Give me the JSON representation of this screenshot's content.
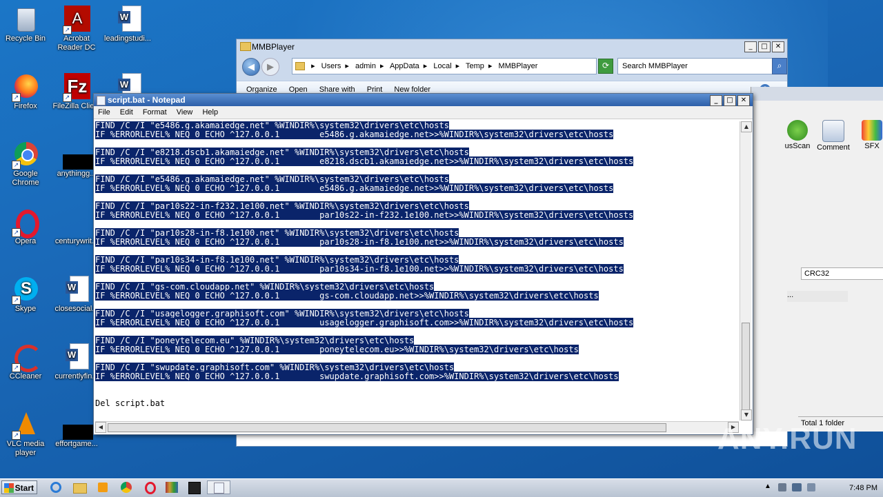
{
  "desktop": {
    "icons": [
      {
        "label": "Recycle Bin"
      },
      {
        "label": "Acrobat Reader DC"
      },
      {
        "label": "leadingstudi..."
      },
      {
        "label": "Firefox"
      },
      {
        "label": "FileZilla Clie..."
      },
      {
        "label": "Google Chrome"
      },
      {
        "label": "anythingg..."
      },
      {
        "label": "Opera"
      },
      {
        "label": "centurywrit..."
      },
      {
        "label": "Skype"
      },
      {
        "label": "closesocial..."
      },
      {
        "label": "CCleaner"
      },
      {
        "label": "currentlyfin..."
      },
      {
        "label": "VLC media player"
      },
      {
        "label": "effortgame..."
      }
    ]
  },
  "explorer": {
    "title": "MMBPlayer",
    "path": [
      "Users",
      "admin",
      "AppData",
      "Local",
      "Temp",
      "MMBPlayer"
    ],
    "search_placeholder": "Search MMBPlayer",
    "commands": [
      "Organize",
      "Open",
      "Share with",
      "Print",
      "New folder"
    ]
  },
  "rar": {
    "tools": [
      "usScan",
      "Comment",
      "SFX"
    ],
    "column": "CRC32",
    "row": "...",
    "status": "Total 1 folder"
  },
  "notepad": {
    "title": "script.bat - Notepad",
    "menu": [
      "File",
      "Edit",
      "Format",
      "View",
      "Help"
    ],
    "lines": [
      {
        "text": "FIND /C /I \"e5486.g.akamaiedge.net\" %WINDIR%\\system32\\drivers\\etc\\hosts",
        "selected": true
      },
      {
        "text": "IF %ERRORLEVEL% NEQ 0 ECHO ^127.0.0.1        e5486.g.akamaiedge.net>>%WINDIR%\\system32\\drivers\\etc\\hosts",
        "selected": true
      },
      {
        "text": "",
        "selected": true
      },
      {
        "text": "FIND /C /I \"e8218.dscb1.akamaiedge.net\" %WINDIR%\\system32\\drivers\\etc\\hosts",
        "selected": true
      },
      {
        "text": "IF %ERRORLEVEL% NEQ 0 ECHO ^127.0.0.1        e8218.dscb1.akamaiedge.net>>%WINDIR%\\system32\\drivers\\etc\\hosts",
        "selected": true
      },
      {
        "text": "",
        "selected": true
      },
      {
        "text": "FIND /C /I \"e5486.g.akamaiedge.net\" %WINDIR%\\system32\\drivers\\etc\\hosts",
        "selected": true
      },
      {
        "text": "IF %ERRORLEVEL% NEQ 0 ECHO ^127.0.0.1        e5486.g.akamaiedge.net>>%WINDIR%\\system32\\drivers\\etc\\hosts",
        "selected": true
      },
      {
        "text": "",
        "selected": true
      },
      {
        "text": "FIND /C /I \"par10s22-in-f232.1e100.net\" %WINDIR%\\system32\\drivers\\etc\\hosts",
        "selected": true
      },
      {
        "text": "IF %ERRORLEVEL% NEQ 0 ECHO ^127.0.0.1        par10s22-in-f232.1e100.net>>%WINDIR%\\system32\\drivers\\etc\\hosts",
        "selected": true
      },
      {
        "text": "",
        "selected": true
      },
      {
        "text": "FIND /C /I \"par10s28-in-f8.1e100.net\" %WINDIR%\\system32\\drivers\\etc\\hosts",
        "selected": true
      },
      {
        "text": "IF %ERRORLEVEL% NEQ 0 ECHO ^127.0.0.1        par10s28-in-f8.1e100.net>>%WINDIR%\\system32\\drivers\\etc\\hosts",
        "selected": true
      },
      {
        "text": "",
        "selected": true
      },
      {
        "text": "FIND /C /I \"par10s34-in-f8.1e100.net\" %WINDIR%\\system32\\drivers\\etc\\hosts",
        "selected": true
      },
      {
        "text": "IF %ERRORLEVEL% NEQ 0 ECHO ^127.0.0.1        par10s34-in-f8.1e100.net>>%WINDIR%\\system32\\drivers\\etc\\hosts",
        "selected": true
      },
      {
        "text": "",
        "selected": true
      },
      {
        "text": "FIND /C /I \"gs-com.cloudapp.net\" %WINDIR%\\system32\\drivers\\etc\\hosts",
        "selected": true
      },
      {
        "text": "IF %ERRORLEVEL% NEQ 0 ECHO ^127.0.0.1        gs-com.cloudapp.net>>%WINDIR%\\system32\\drivers\\etc\\hosts",
        "selected": true
      },
      {
        "text": "",
        "selected": true
      },
      {
        "text": "FIND /C /I \"usagelogger.graphisoft.com\" %WINDIR%\\system32\\drivers\\etc\\hosts",
        "selected": true
      },
      {
        "text": "IF %ERRORLEVEL% NEQ 0 ECHO ^127.0.0.1        usagelogger.graphisoft.com>>%WINDIR%\\system32\\drivers\\etc\\hosts",
        "selected": true
      },
      {
        "text": "",
        "selected": true
      },
      {
        "text": "FIND /C /I \"poneytelecom.eu\" %WINDIR%\\system32\\drivers\\etc\\hosts",
        "selected": true
      },
      {
        "text": "IF %ERRORLEVEL% NEQ 0 ECHO ^127.0.0.1        poneytelecom.eu>>%WINDIR%\\system32\\drivers\\etc\\hosts",
        "selected": true
      },
      {
        "text": "",
        "selected": true
      },
      {
        "text": "FIND /C /I \"swupdate.graphisoft.com\" %WINDIR%\\system32\\drivers\\etc\\hosts",
        "selected": true
      },
      {
        "text": "IF %ERRORLEVEL% NEQ 0 ECHO ^127.0.0.1        swupdate.graphisoft.com>>%WINDIR%\\system32\\drivers\\etc\\hosts",
        "selected": true
      },
      {
        "text": "",
        "selected": false
      },
      {
        "text": "",
        "selected": false
      },
      {
        "text": "Del script.bat",
        "selected": false
      }
    ]
  },
  "taskbar": {
    "start_label": "Start",
    "clock": "7:48 PM"
  },
  "watermark": "ANY.RUN",
  "colors": {
    "selection": "#0a246a",
    "desktop": "#1a69b8"
  }
}
